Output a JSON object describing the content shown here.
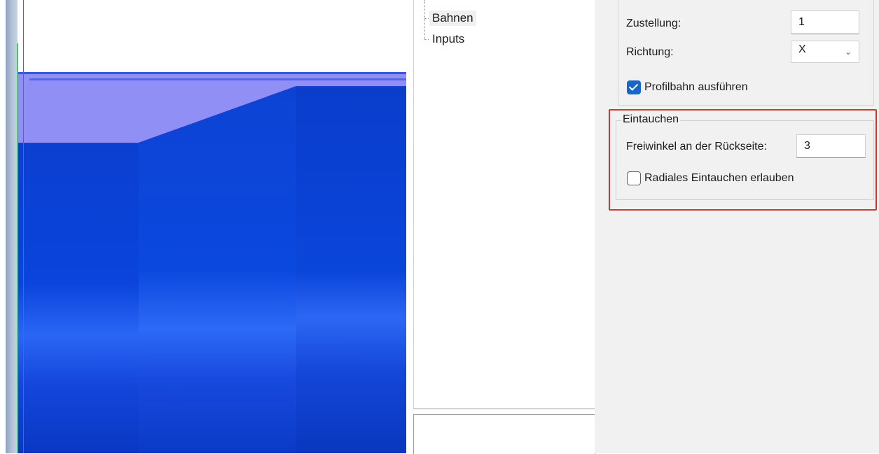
{
  "tree": {
    "items": [
      {
        "label": "Bahnen",
        "selected": true
      },
      {
        "label": "Inputs",
        "selected": false
      }
    ]
  },
  "properties": {
    "zustellung": {
      "label": "Zustellung:",
      "value": "1"
    },
    "richtung": {
      "label": "Richtung:",
      "value": "X"
    },
    "profilbahn": {
      "label": "Profilbahn ausführen",
      "checked": true
    },
    "eintauchen": {
      "legend": "Eintauchen",
      "freiwinkel": {
        "label": "Freiwinkel an der Rückseite:",
        "value": "3"
      },
      "radial": {
        "label": "Radiales Eintauchen erlauben",
        "checked": false
      }
    }
  },
  "colors": {
    "highlight": "#d3352b",
    "checkbox_accent": "#1966c9",
    "model_blue": "#0a3fd2",
    "model_top": "#8f8ff6"
  }
}
